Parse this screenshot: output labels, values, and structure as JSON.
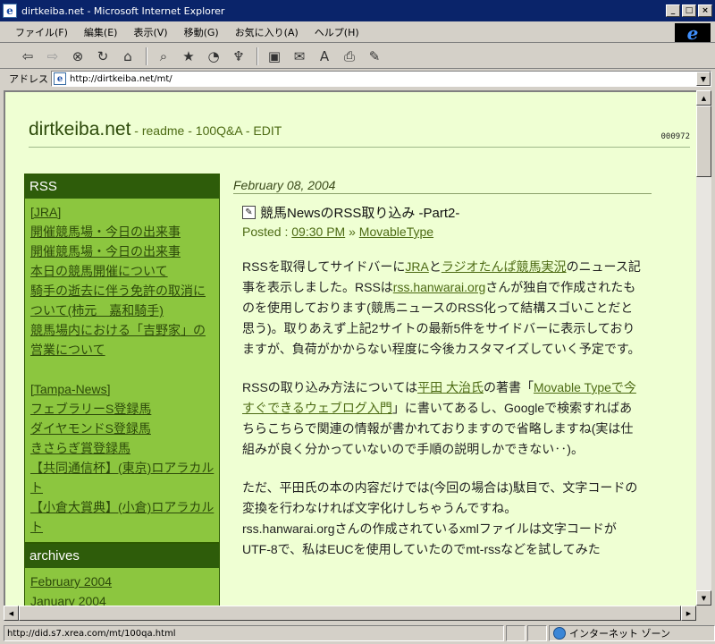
{
  "window": {
    "title": "dirtkeiba.net - Microsoft Internet Explorer",
    "buttons": {
      "minimize": "_",
      "maximize": "□",
      "close": "×"
    }
  },
  "menu": [
    "ファイル(F)",
    "編集(E)",
    "表示(V)",
    "移動(G)",
    "お気に入り(A)",
    "ヘルプ(H)"
  ],
  "toolbar_icons": [
    "back-arrow-icon",
    "forward-arrow-icon",
    "stop-icon",
    "refresh-icon",
    "home-icon",
    "search-icon",
    "favorites-icon",
    "history-icon",
    "channels-icon",
    "fullscreen-icon",
    "mail-icon",
    "font-icon",
    "print-icon",
    "edit-icon"
  ],
  "address": {
    "label": "アドレス",
    "url": "http://dirtkeiba.net/mt/"
  },
  "status": {
    "url": "http://did.s7.xrea.com/mt/100qa.html",
    "zone": "インターネット ゾーン"
  },
  "site": {
    "name": "dirtkeiba.net",
    "sep1": " - ",
    "link1": "readme",
    "sep2": " - ",
    "link2": "100Q&A",
    "sep3": " - ",
    "link3": "EDIT",
    "counter": "000972"
  },
  "sidebar": {
    "rss": {
      "heading": "RSS",
      "group1": [
        "[JRA]",
        "開催競馬場・今日の出来事",
        "開催競馬場・今日の出来事",
        "本日の競馬開催について",
        "騎手の逝去に伴う免許の取消について(柿元　嘉和騎手)",
        "競馬場内における「吉野家」の営業について"
      ],
      "group2": [
        "[Tampa-News]",
        "フェブラリーS登録馬",
        "ダイヤモンドS登録馬",
        "きさらぎ賞登録馬",
        "【共同通信杯】(東京)ロアラカルト",
        "【小倉大賞典】(小倉)ロアラカルト"
      ]
    },
    "archives": {
      "heading": "archives",
      "items": [
        "February 2004",
        "January 2004"
      ]
    }
  },
  "post": {
    "date": "February 08, 2004",
    "title": "競馬NewsのRSS取り込み -Part2-",
    "posted_label": "Posted : ",
    "time": "09:30 PM",
    "sep": " » ",
    "category": "MovableType",
    "p1": {
      "t1": "RSSを取得してサイドバーに",
      "l1": "JRA",
      "t2": "と",
      "l2": "ラジオたんぱ競馬実況",
      "t3": "のニュース記事を表示しました。RSSは",
      "l3": "rss.hanwarai.org",
      "t4": "さんが独自で作成されたものを使用しております(競馬ニュースのRSS化って結構スゴいことだと思う)。取りあえず上記2サイトの最新5件をサイドバーに表示しておりますが、負荷がかからない程度に今後カスタマイズしていく予定です。"
    },
    "p2": {
      "t1": "RSSの取り込み方法については",
      "l1": "平田 大治氏",
      "t2": "の著書「",
      "l2": "Movable Typeで今すぐできるウェブログ入門",
      "t3": "」に書いてあるし、Googleで検索すればあちらこちらで関連の情報が書かれておりますので省略しますね(実は仕組みが良く分かっていないので手順の説明しかできない‥)。"
    },
    "p3": "ただ、平田氏の本の内容だけでは(今回の場合は)駄目で、文字コードの変換を行わなければ文字化けしちゃうんですね。",
    "p4": "rss.hanwarai.orgさんの作成されているxmlファイルは文字コードがUTF-8で、私はEUCを使用していたのでmt-rssなどを試してみた"
  }
}
